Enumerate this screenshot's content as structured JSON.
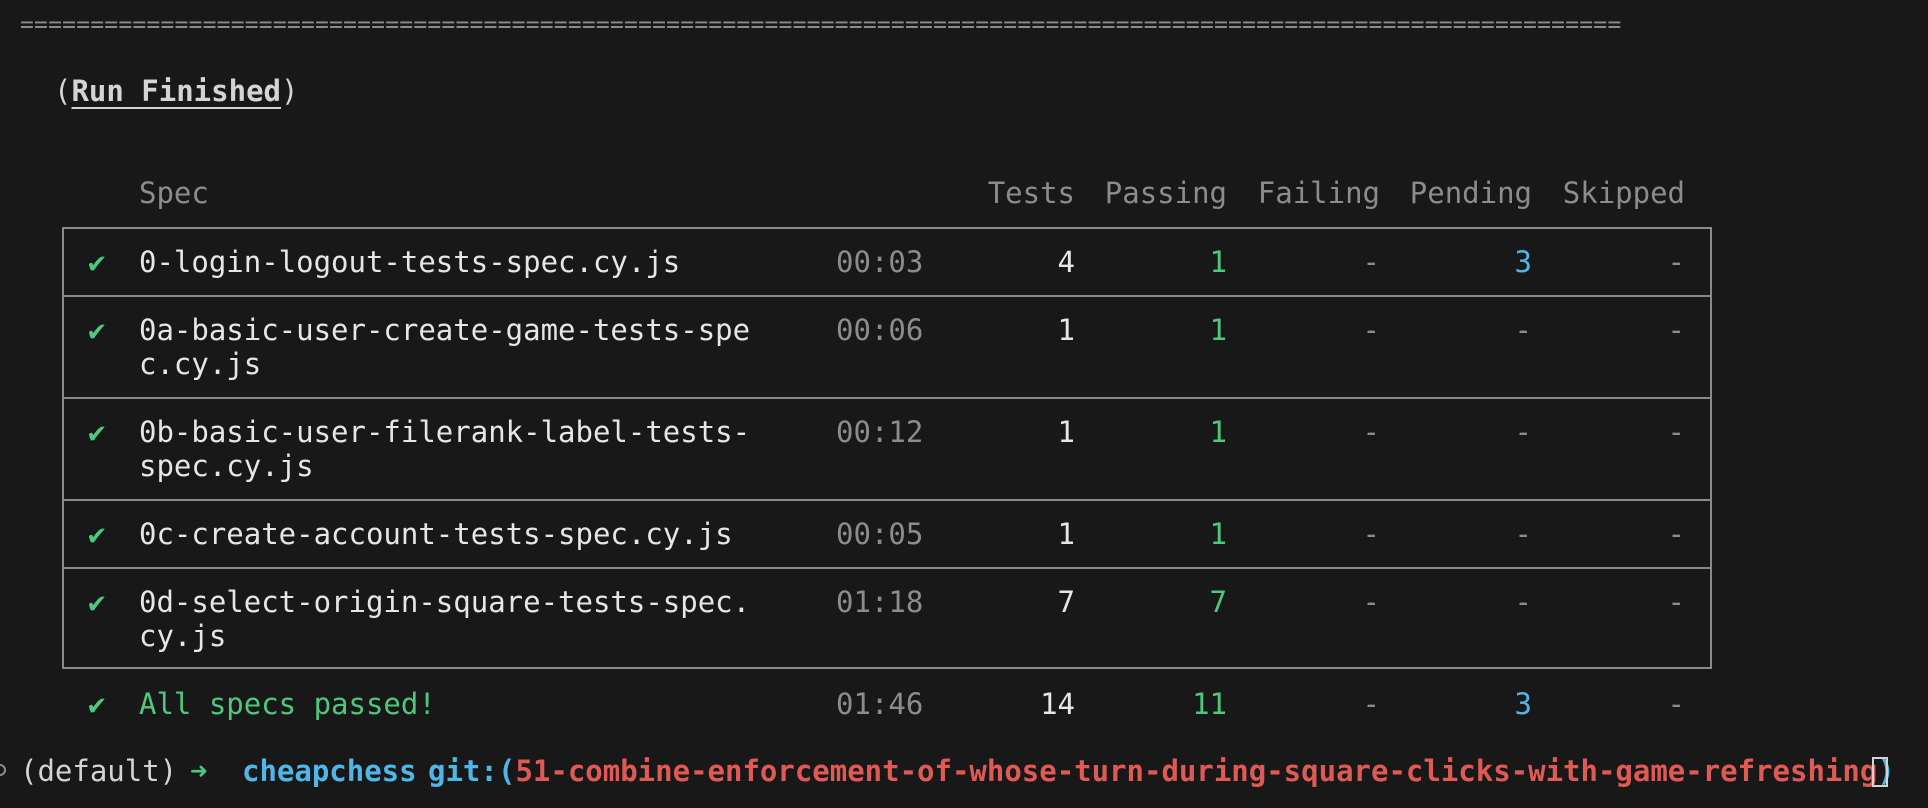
{
  "separator": "==================================================================================================================",
  "run_status": {
    "open": "(",
    "label": "Run Finished",
    "close": ")"
  },
  "table": {
    "headers": {
      "spec": "Spec",
      "tests": "Tests",
      "passing": "Passing",
      "failing": "Failing",
      "pending": "Pending",
      "skipped": "Skipped"
    },
    "rows": [
      {
        "check": "✔",
        "spec_line1": "0-login-logout-tests-spec.cy.js",
        "spec_line2": "",
        "time": "00:03",
        "tests": "4",
        "passing": "1",
        "failing": "-",
        "pending": "3",
        "skipped": "-"
      },
      {
        "check": "✔",
        "spec_line1": "0a-basic-user-create-game-tests-spe",
        "spec_line2": "c.cy.js",
        "time": "00:06",
        "tests": "1",
        "passing": "1",
        "failing": "-",
        "pending": "-",
        "skipped": "-"
      },
      {
        "check": "✔",
        "spec_line1": "0b-basic-user-filerank-label-tests-",
        "spec_line2": "spec.cy.js",
        "time": "00:12",
        "tests": "1",
        "passing": "1",
        "failing": "-",
        "pending": "-",
        "skipped": "-"
      },
      {
        "check": "✔",
        "spec_line1": "0c-create-account-tests-spec.cy.js",
        "spec_line2": "",
        "time": "00:05",
        "tests": "1",
        "passing": "1",
        "failing": "-",
        "pending": "-",
        "skipped": "-"
      },
      {
        "check": "✔",
        "spec_line1": "0d-select-origin-square-tests-spec.",
        "spec_line2": "cy.js",
        "time": "01:18",
        "tests": "7",
        "passing": "7",
        "failing": "-",
        "pending": "-",
        "skipped": "-"
      }
    ],
    "summary": {
      "check": "✔",
      "label": "All specs passed!",
      "time": "01:46",
      "tests": "14",
      "passing": "11",
      "failing": "-",
      "pending": "3",
      "skipped": "-"
    }
  },
  "prompt": {
    "env": "(default)",
    "arrow": "➜",
    "directory": "cheapchess",
    "git_label": "git:",
    "paren_open": "(",
    "branch": "51-combine-enforcement-of-whose-turn-during-square-clicks-with-game-refreshing",
    "paren_close": ")"
  },
  "colors": {
    "background": "#181818",
    "pass": "#4ec97b",
    "pending": "#4fb6e8",
    "branch": "#e05a55"
  }
}
